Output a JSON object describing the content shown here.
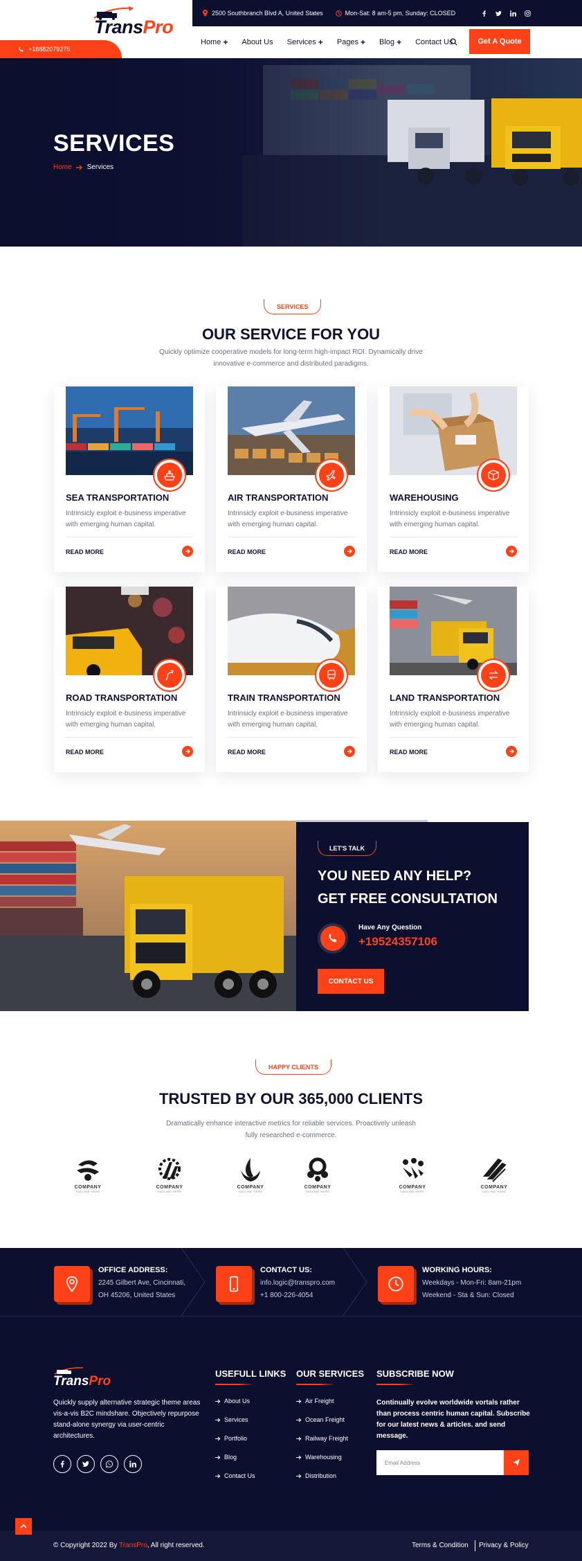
{
  "header": {
    "logo_trans": "Trans",
    "logo_pro": "Pro",
    "address": "2500 Southbranch Blvd A, United States",
    "hours": "Mon-Sat: 8 am-5 pm, Sunday: CLOSED",
    "phone": "+18882079275",
    "social_icons": [
      "facebook-icon",
      "twitter-icon",
      "linkedin-icon",
      "instagram-icon"
    ],
    "nav": [
      {
        "label": "Home",
        "has_sub": true
      },
      {
        "label": "About Us",
        "has_sub": false
      },
      {
        "label": "Services",
        "has_sub": true
      },
      {
        "label": "Pages",
        "has_sub": true
      },
      {
        "label": "Blog",
        "has_sub": true
      },
      {
        "label": "Contact Us",
        "has_sub": false
      }
    ],
    "quote_label": "Get A Quote"
  },
  "hero": {
    "title": "SERVICES",
    "crumb_home": "Home",
    "crumb_current": "Services"
  },
  "services": {
    "pill": "SERVICES",
    "title": "OUR SERVICE FOR YOU",
    "desc_line1": "Quickly optimize cooperative models for long-term high-impact ROI. Dynamically drive",
    "desc_line2": "innovative e-commerce and distributed paradigms.",
    "read_more": "READ MORE",
    "card_desc": "Intrinsicly exploit e-business imperative with emerging human capital.",
    "cards": [
      {
        "title": "SEA TRANSPORTATION",
        "icon": "ship-icon"
      },
      {
        "title": "AIR TRANSPORTATION",
        "icon": "airplane-icon"
      },
      {
        "title": "WAREHOUSING",
        "icon": "box-icon"
      },
      {
        "title": "ROAD TRANSPORTATION",
        "icon": "road-icon"
      },
      {
        "title": "TRAIN TRANSPORTATION",
        "icon": "train-icon"
      },
      {
        "title": "LAND TRANSPORTATION",
        "icon": "transfer-icon"
      }
    ]
  },
  "consult": {
    "pill": "LET'S TALK",
    "line1": "YOU NEED ANY HELP?",
    "line2": "GET FREE CONSULTATION",
    "have_question": "Have Any Question",
    "phone": "+19524357106",
    "button": "CONTACT US"
  },
  "clients": {
    "pill": "HAPPY CLIENTS",
    "title": "TRUSTED BY OUR 365,000 CLIENTS",
    "desc_line1": "Dramatically enhance interactive metrics for reliable services. Proactively unleash",
    "desc_line2": "fully researched e-commerce.",
    "logo_name": "COMPANY",
    "logo_tag": "TAGLINE HERE"
  },
  "contact_strip": [
    {
      "heading": "OFFICE ADDRESS:",
      "line1": "2245 Gilbert Ave, Cincinnati,",
      "line2": "OH 45206, United States",
      "icon": "location-pin-icon"
    },
    {
      "heading": "CONTACT US:",
      "line1": "info.logic@transpro.com",
      "line2": "+1 800-226-4054",
      "icon": "mobile-phone-icon"
    },
    {
      "heading": "WORKING HOURS:",
      "line1": "Weekdays - Mon-Fri: 8am-21pm",
      "line2": "Weekend - Sta & Sun: Closed",
      "icon": "clock-icon"
    }
  ],
  "footer": {
    "about": "Quickly supply alternative strategic theme areas vis-a-vis B2C mindshare. Objectively repurpose stand-alone synergy via user-centric architectures.",
    "social_icons": [
      "facebook-icon",
      "twitter-icon",
      "whatsapp-icon",
      "linkedin-icon"
    ],
    "links_heading": "USEFULL LINKS",
    "links": [
      "About Us",
      "Services",
      "Portfolio",
      "Blog",
      "Contact Us"
    ],
    "services_heading": "OUR SERVICES",
    "services": [
      "Air Freight",
      "Ocean Freight",
      "Railway Freight",
      "Warehousing",
      "Distribution"
    ],
    "subscribe_heading": "SUBSCRIBE NOW",
    "subscribe_text": "Continually evolve worldwide vortals rather than process centric human capital. Subscribe for our latest news & articles. and send message.",
    "email_placeholder": "Email Address",
    "copy_prefix": "© Copyright 2022 By ",
    "copy_brand": "TransPro",
    "copy_suffix": ", All right reserved.",
    "terms": "Terms & Condition",
    "privacy": "Privacy & Policy"
  },
  "colors": {
    "accent": "#ff4118",
    "navy": "#0c0f2e"
  }
}
